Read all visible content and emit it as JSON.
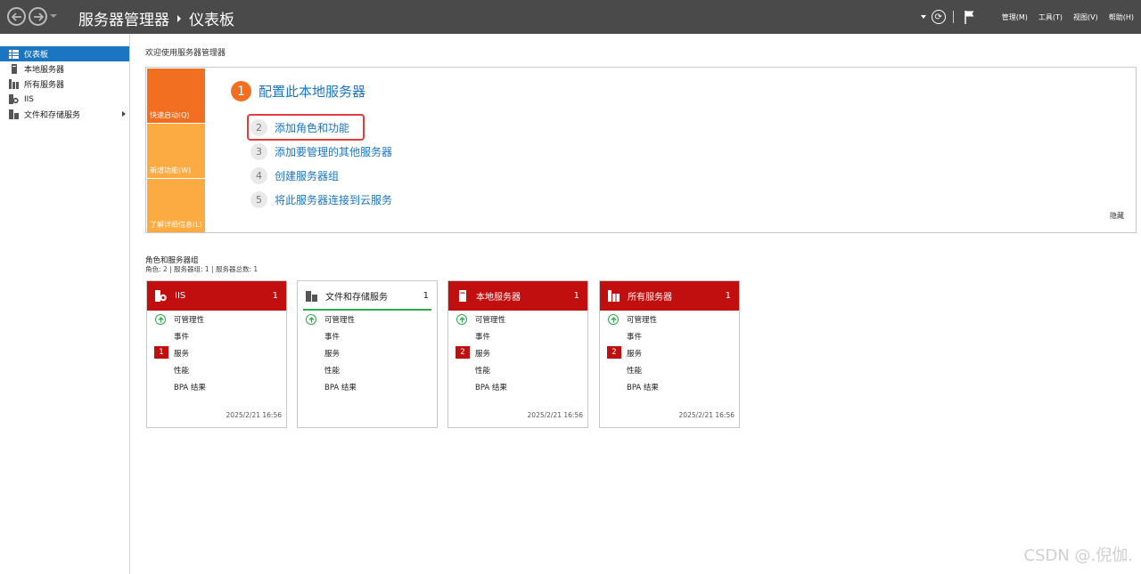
{
  "titlebar": {
    "app_name": "服务器管理器",
    "page_name": "仪表板",
    "menus": [
      "管理(M)",
      "工具(T)",
      "视图(V)",
      "帮助(H)"
    ]
  },
  "sidebar": {
    "items": [
      {
        "label": "仪表板",
        "icon": "dashboard-icon",
        "active": true
      },
      {
        "label": "本地服务器",
        "icon": "server-icon"
      },
      {
        "label": "所有服务器",
        "icon": "servers-icon"
      },
      {
        "label": "IIS",
        "icon": "iis-icon"
      },
      {
        "label": "文件和存储服务",
        "icon": "storage-icon",
        "expandable": true
      }
    ]
  },
  "welcome": {
    "title": "欢迎使用服务器管理器",
    "tiles": [
      "快速启动(Q)",
      "新增功能(W)",
      "了解详细信息(L)"
    ],
    "step1": {
      "num": "1",
      "text": "配置此本地服务器"
    },
    "steps": [
      {
        "num": "2",
        "text": "添加角色和功能"
      },
      {
        "num": "3",
        "text": "添加要管理的其他服务器"
      },
      {
        "num": "4",
        "text": "创建服务器组"
      },
      {
        "num": "5",
        "text": "将此服务器连接到云服务"
      }
    ],
    "hide": "隐藏"
  },
  "roles": {
    "title": "角色和服务器组",
    "subtitle": "角色: 2 | 服务器组: 1 | 服务器总数: 1",
    "cards": [
      {
        "name": "IIS",
        "count": "1",
        "alert": true,
        "services_badge": "1",
        "time": "2025/2/21 16:56"
      },
      {
        "name": "文件和存储服务",
        "count": "1",
        "alert": false,
        "services_badge": "",
        "time": ""
      },
      {
        "name": "本地服务器",
        "count": "1",
        "alert": true,
        "services_badge": "2",
        "time": "2025/2/21 16:56"
      },
      {
        "name": "所有服务器",
        "count": "1",
        "alert": true,
        "services_badge": "2",
        "time": "2025/2/21 16:56"
      }
    ],
    "rows": [
      "可管理性",
      "事件",
      "服务",
      "性能",
      "BPA 结果"
    ]
  },
  "colors": {
    "accent": "#1a76c2",
    "alert_red": "#c10f0f",
    "orange": "#f26f21",
    "light_orange": "#fbab42",
    "green": "#2fa84f"
  },
  "watermark": "CSDN @.倪伽."
}
